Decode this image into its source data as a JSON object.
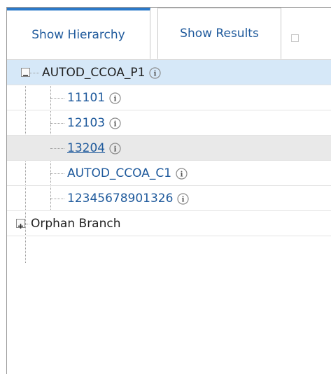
{
  "tabs": {
    "hierarchy_label": "Show Hierarchy",
    "results_label": "Show Results"
  },
  "tree": {
    "root": {
      "label": "AUTOD_CCOA_P1",
      "expanded": true
    },
    "children": [
      {
        "label": "11101"
      },
      {
        "label": "12103"
      },
      {
        "label": "13204"
      },
      {
        "label": "AUTOD_CCOA_C1"
      },
      {
        "label": "12345678901326"
      }
    ],
    "orphan": {
      "label": "Orphan Branch",
      "expanded": false
    }
  },
  "colors": {
    "link": "#1f5a9c",
    "tab_accent": "#2b79c9",
    "selected_row": "#d6e8f8",
    "hover_row": "#e9e9e9"
  }
}
